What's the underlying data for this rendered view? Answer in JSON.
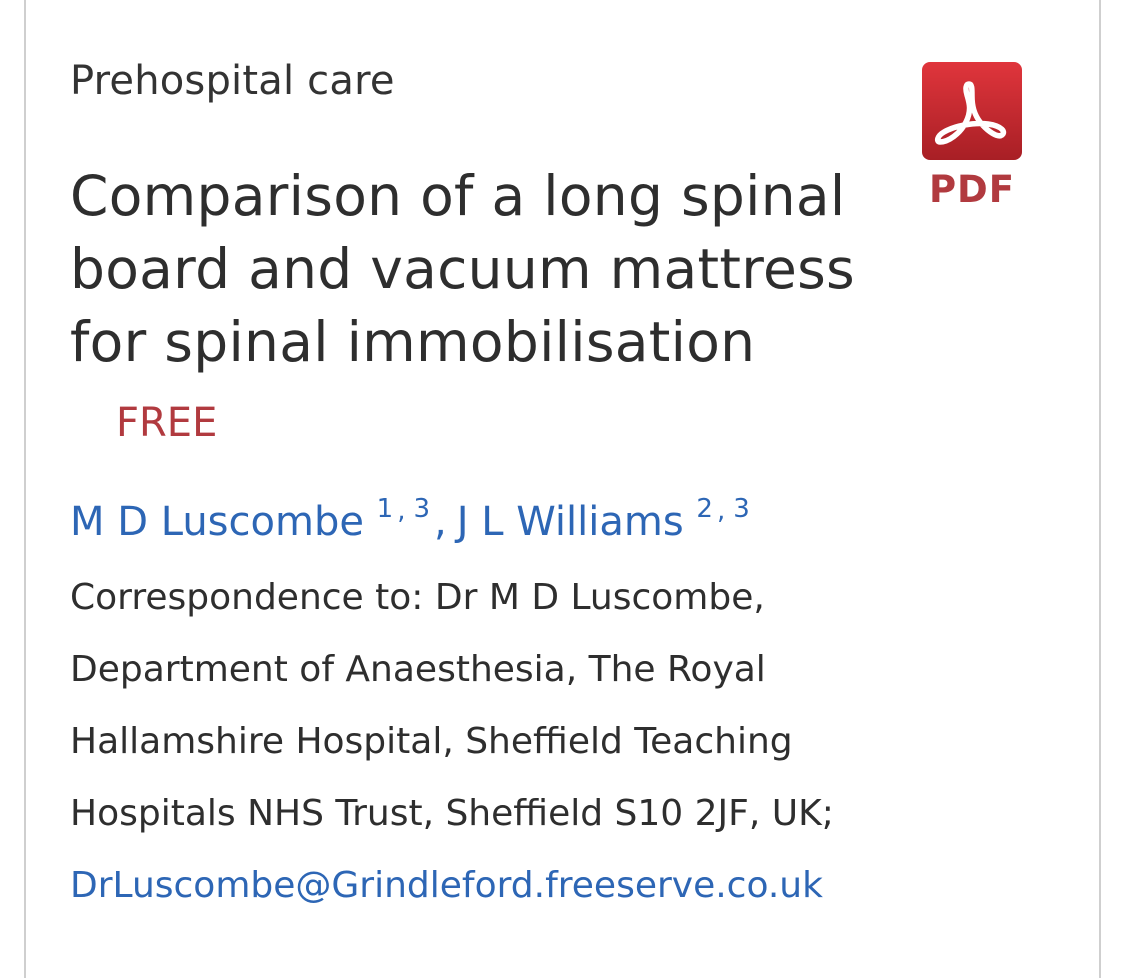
{
  "article": {
    "category": "Prehospital care",
    "title": "Comparison of a long spinal board and vacuum mattress for spinal immobilisation",
    "access_badge": "FREE",
    "pdf_label": "PDF",
    "pdf_icon": "adobe-pdf-icon",
    "accent_color": "#b13a3f",
    "link_color": "#2d66b5",
    "authors": [
      {
        "name": "M D Luscombe",
        "aff1": "1",
        "aff2": "3"
      },
      {
        "name": "J L Williams",
        "aff1": "2",
        "aff2": "3"
      }
    ],
    "author_separator": ",",
    "affiliation_separator": ",",
    "correspondence_lines": [
      "Correspondence to: Dr M D Luscombe,",
      "Department of Anaesthesia, The Royal",
      "Hallamshire Hospital, Sheffield Teaching",
      "Hospitals NHS Trust, Sheffield S10 2JF, UK;"
    ],
    "email": "DrLuscombe@Grindleford.freeserve.co.uk"
  }
}
